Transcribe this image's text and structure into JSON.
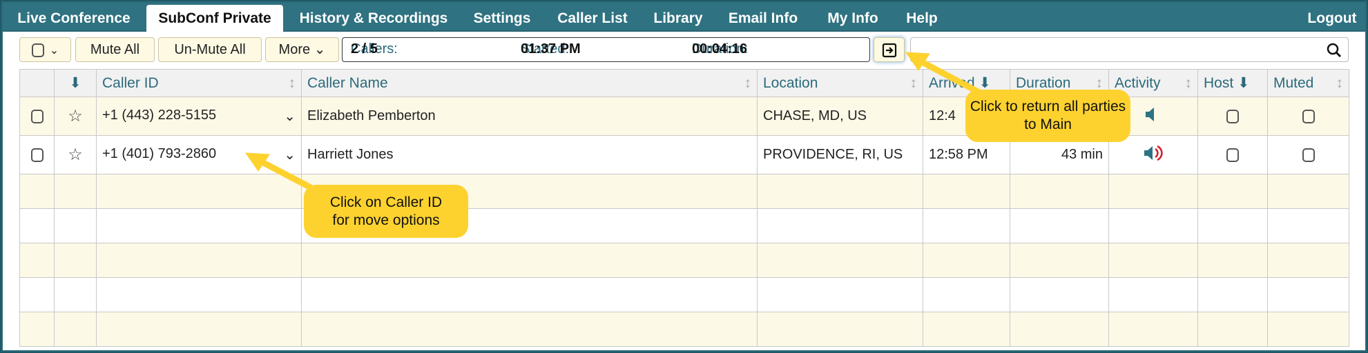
{
  "tabs": [
    "Live Conference",
    "SubConf Private",
    "History & Recordings",
    "Settings",
    "Caller List",
    "Library",
    "Email Info",
    "My Info",
    "Help"
  ],
  "active_tab": "SubConf Private",
  "logout": "Logout",
  "toolbar": {
    "mute_all": "Mute All",
    "unmute_all": "Un-Mute All",
    "more": "More",
    "callers_label": "Callers:",
    "callers_value": "2 / 5",
    "started_label": "Started:",
    "started_value": "01:37 PM",
    "duration_label": "Duration:",
    "duration_value": "00:04:16",
    "search_placeholder": ""
  },
  "columns": [
    "Caller ID",
    "Caller Name",
    "Location",
    "Arrived",
    "Duration",
    "Activity",
    "Host",
    "Muted"
  ],
  "rows": [
    {
      "caller_id": "+1 (443) 228-5155",
      "name": "Elizabeth Pemberton",
      "location": "CHASE, MD, US",
      "arrived": "12:4",
      "duration": "",
      "activity": "speaker-icon"
    },
    {
      "caller_id": "+1 (401) 793-2860",
      "name": "Harriett Jones",
      "location": "PROVIDENCE, RI, US",
      "arrived": "12:58 PM",
      "duration": "43 min",
      "activity": "speaker-talking-icon"
    }
  ],
  "callouts": {
    "return": "Click to return all parties to Main",
    "caller_id": "Click on Caller ID for move options"
  },
  "colors": {
    "tab_bar": "#2f7281",
    "accent": "#2a6a7c",
    "row_alt": "#fdf9e7",
    "callout": "#fdd22f",
    "talking": "#d0202a"
  }
}
